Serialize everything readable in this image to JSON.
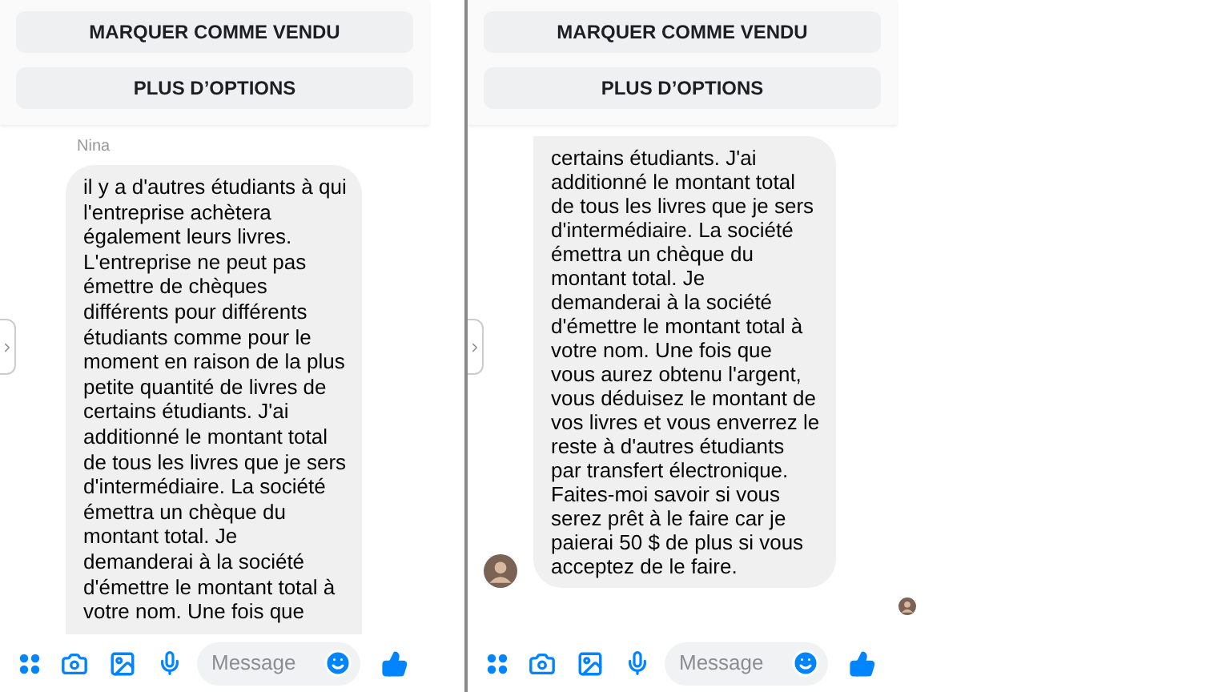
{
  "panels": [
    {
      "actions": [
        "MARQUER COMME VENDU",
        "PLUS D’OPTIONS"
      ],
      "sender": "Nina",
      "message": {
        "avatar": false,
        "lines": [
          "il y a d'autres étudiants à qui",
          "l'entreprise achètera",
          "également leurs livres.",
          "L'entreprise ne peut pas",
          "émettre de chèques",
          "différents pour différents",
          "étudiants comme pour le",
          "moment en raison de la plus",
          "petite quantité de livres de",
          "certains étudiants. J'ai",
          "additionné le montant total",
          "de tous les livres que je sers",
          "d'intermédiaire. La société",
          "émettra un chèque du",
          "montant total. Je",
          "demanderai à la société",
          "d'émettre le montant total à",
          "votre nom. Une fois que"
        ]
      },
      "composer": {
        "placeholder": "Message"
      }
    },
    {
      "actions": [
        "MARQUER COMME VENDU",
        "PLUS D’OPTIONS"
      ],
      "message": {
        "avatar": true,
        "lines": [
          "certains étudiants. J'ai",
          "additionné le montant total",
          "de tous les livres que je sers",
          "d'intermédiaire. La société",
          "émettra un chèque du",
          "montant total. Je",
          "demanderai à la société",
          "d'émettre le montant total à",
          "votre nom. Une fois que",
          "vous aurez obtenu l'argent,",
          "vous déduisez le montant de",
          "vos livres et vous enverrez le",
          "reste à d'autres étudiants",
          "par transfert électronique.",
          "Faites-moi savoir si vous",
          "serez prêt à le faire car je",
          "paierai 50 $ de plus si vous",
          "acceptez de le faire."
        ]
      },
      "read_receipt": true,
      "composer": {
        "placeholder": "Message"
      }
    }
  ]
}
